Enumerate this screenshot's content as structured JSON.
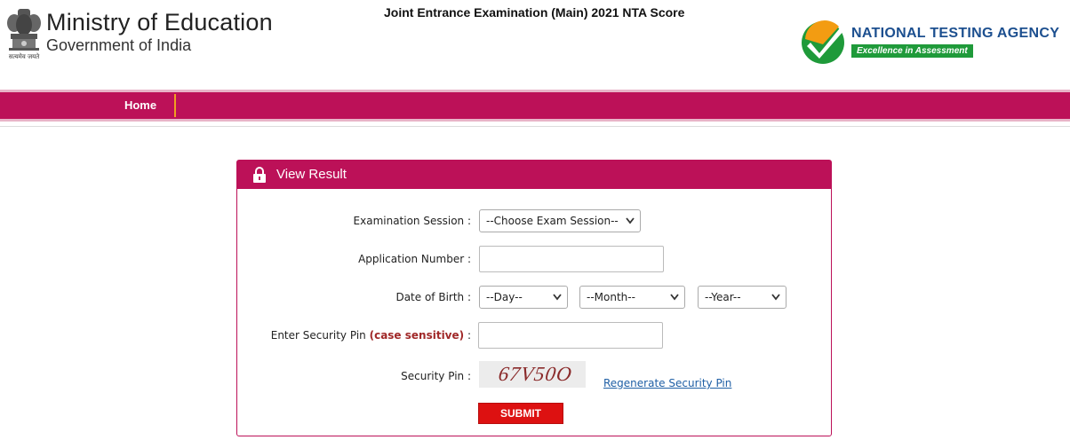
{
  "header": {
    "emblem_motto": "सत्यमेव जयते",
    "ministry_title": "Ministry of Education",
    "ministry_subtitle": "Government of India",
    "exam_title": "Joint Entrance Examination (Main) 2021 NTA Score",
    "agency_name": "NATIONAL TESTING AGENCY",
    "agency_tagline": "Excellence in Assessment"
  },
  "nav": {
    "home_label": "Home"
  },
  "form": {
    "panel_title": "View Result",
    "session_label": "Examination Session :",
    "session_value": "--Choose Exam Session--",
    "application_label": "Application Number :",
    "application_value": "",
    "dob_label": "Date of Birth :",
    "dob_day": "--Day--",
    "dob_month": "--Month--",
    "dob_year": "--Year--",
    "pin_label_prefix": "Enter Security Pin",
    "pin_label_note": "(case sensitive)",
    "pin_label_suffix": ":",
    "pin_value": "",
    "captcha_label": "Security Pin :",
    "captcha_text": "67V50O",
    "regenerate_label": "Regenerate Security Pin",
    "submit_label": "SUBMIT"
  },
  "colors": {
    "brand": "#bc1158",
    "submit": "#dd1111",
    "link": "#1f5fa5"
  },
  "icons": [
    "ashoka-emblem-icon",
    "nta-check-logo-icon",
    "lock-icon",
    "chevron-down-icon"
  ]
}
